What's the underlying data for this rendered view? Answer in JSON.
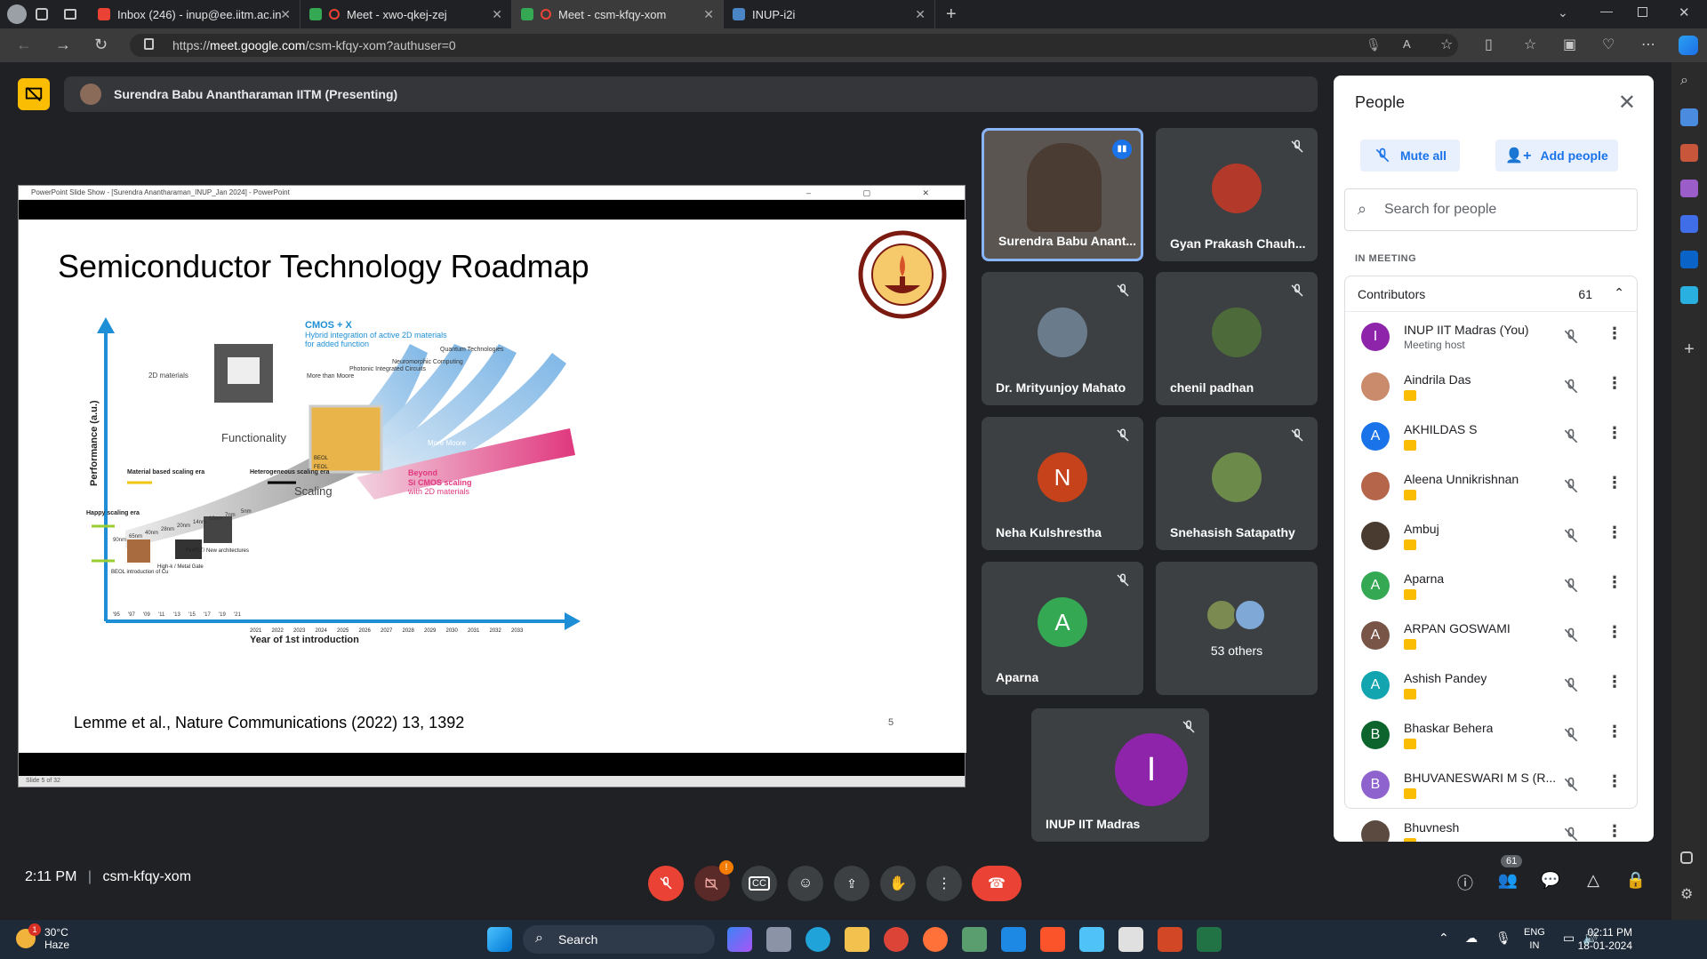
{
  "browser": {
    "tabs": [
      {
        "title": "Inbox (246) - inup@ee.iitm.ac.in",
        "fav": "#ea4335"
      },
      {
        "title": "Meet - xwo-qkej-zej",
        "fav": "#34a853"
      },
      {
        "title": "Meet - csm-kfqy-xom",
        "fav": "#34a853"
      },
      {
        "title": "INUP-i2i",
        "fav": "#4a86c5"
      }
    ],
    "url_scheme": "https://",
    "url_host": "meet.google.com",
    "url_path": "/csm-kfqy-xom?authuser=0"
  },
  "presenting": {
    "label": "Surendra Babu Anantharaman IITM (Presenting)"
  },
  "ppt": {
    "window_title": "PowerPoint Slide Show - [Surendra Anantharaman_INUP_Jan 2024] - PowerPoint",
    "status": "Slide 5 of 32",
    "slide_title": "Semiconductor Technology Roadmap",
    "citation": "Lemme et al., Nature Communications (2022) 13, 1392",
    "slide_number": "5",
    "figure": {
      "y_axis": "Performance (a.u.)",
      "x_axis": "Year of 1st introduction",
      "labels": {
        "cmos_x": "CMOS + X",
        "cmos_x_sub1": "Hybrid integration of active 2D materials",
        "cmos_x_sub2": "for added function",
        "twod": "2D materials",
        "more_than_moore": "More than Moore",
        "photonic": "Photonic Integrated Circuits",
        "neuromorphic": "Neuromorphic Computing",
        "quantum": "Quantum Technologies",
        "functionality": "Functionality",
        "scaling": "Scaling",
        "more_moore": "More Moore",
        "beyond1": "Beyond",
        "beyond2": "Si CMOS scaling",
        "beyond3": "with 2D materials",
        "hetero": "Heterogeneous scaling era",
        "material": "Material based scaling era",
        "happy": "Happy scaling era",
        "beol": "BEOL introduction of Cu",
        "highk": "High-k / Metal Gate",
        "finfet": "FinFET/ New architectures",
        "feol": "FEOL",
        "beol_chip": "BEOL"
      },
      "nodes": [
        "90nm",
        "65nm",
        "40nm",
        "28nm",
        "20nm",
        "14nm",
        "10nm",
        "7nm",
        "5nm"
      ],
      "early_years": [
        "'95",
        "'97",
        "'09",
        "'11",
        "'13",
        "'15",
        "'17",
        "'19",
        "'21"
      ],
      "years": [
        "2021",
        "2022",
        "2023",
        "2024",
        "2025",
        "2026",
        "2027",
        "2028",
        "2029",
        "2030",
        "2031",
        "2032",
        "2033"
      ]
    }
  },
  "tiles": [
    {
      "name": "Surendra Babu Anant...",
      "type": "video",
      "speaking": true
    },
    {
      "name": "Gyan Prakash Chauh...",
      "type": "photo",
      "color": "#b33a2a"
    },
    {
      "name": "Dr. Mrityunjoy Mahato",
      "type": "photo",
      "color": "#6a7c8c"
    },
    {
      "name": "chenil padhan",
      "type": "photo",
      "color": "#4d6b3a"
    },
    {
      "name": "Neha Kulshrestha",
      "type": "letter",
      "letter": "N",
      "color": "#c5421a"
    },
    {
      "name": "Snehasish Satapathy",
      "type": "photo",
      "color": "#6c8a4a"
    },
    {
      "name": "Aparna",
      "type": "letter",
      "letter": "A",
      "color": "#34a853"
    },
    {
      "name": "53 others",
      "type": "others"
    },
    {
      "name": "INUP IIT Madras",
      "type": "letter",
      "letter": "I",
      "color": "#8e24aa"
    }
  ],
  "people": {
    "title": "People",
    "mute_all": "Mute all",
    "add_people": "Add people",
    "search_placeholder": "Search for people",
    "in_meeting": "IN MEETING",
    "contributors": "Contributors",
    "count": "61",
    "list": [
      {
        "name": "INUP IIT Madras (You)",
        "sub": "Meeting host",
        "letter": "I",
        "color": "#8e24aa"
      },
      {
        "name": "Aindrila Das",
        "letter": "",
        "color": "#c98b6b"
      },
      {
        "name": "AKHILDAS S",
        "letter": "A",
        "color": "#1a73e8"
      },
      {
        "name": "Aleena Unnikrishnan",
        "letter": "",
        "color": "#b5654a"
      },
      {
        "name": "Ambuj",
        "letter": "",
        "color": "#4a3b30"
      },
      {
        "name": "Aparna",
        "letter": "A",
        "color": "#34a853"
      },
      {
        "name": "ARPAN GOSWAMI",
        "letter": "A",
        "color": "#795548"
      },
      {
        "name": "Ashish Pandey",
        "letter": "A",
        "color": "#12a4af"
      },
      {
        "name": "Bhaskar Behera",
        "letter": "B",
        "color": "#0d652d"
      },
      {
        "name": "BHUVANESWARI M S (R...",
        "letter": "B",
        "color": "#8e63ce"
      },
      {
        "name": "Bhuvnesh",
        "letter": "",
        "color": "#5a4a40"
      }
    ]
  },
  "controls": {
    "time": "2:11 PM",
    "separator": "|",
    "meeting_code": "csm-kfqy-xom",
    "camera_alert": "!",
    "people_badge": "61"
  },
  "taskbar": {
    "temp": "30°C",
    "weather": "Haze",
    "weather_badge": "1",
    "search": "Search",
    "lang1": "ENG",
    "lang2": "IN",
    "time": "02:11 PM",
    "date": "18-01-2024"
  }
}
